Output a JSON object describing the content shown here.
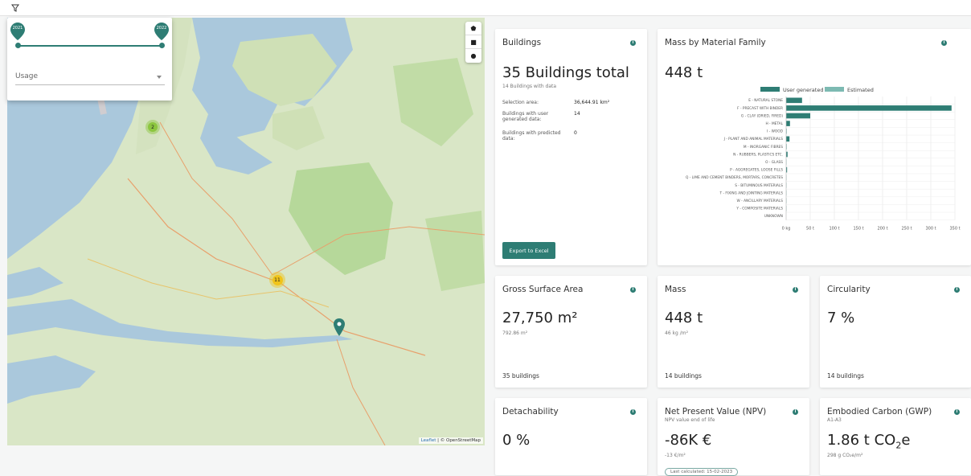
{
  "filter_panel": {
    "year_from": "2021",
    "year_to": "2022",
    "usage_placeholder": "Usage"
  },
  "map": {
    "clusters": [
      {
        "label": "2",
        "color": "#8cc63f"
      },
      {
        "label": "11",
        "color": "#f0c419"
      }
    ],
    "controls": [
      "pentagon-icon",
      "square-icon",
      "circle-icon"
    ],
    "attribution_leaflet": "Leaflet",
    "attribution_osm": "| © OpenStreetMap"
  },
  "buildings": {
    "title": "Buildings",
    "total": "35 Buildings total",
    "with_data": "14 Buildings with data",
    "rows": [
      {
        "label": "Selection area:",
        "value": "36,644.91 km²"
      },
      {
        "label": "Buildings with user generated data:",
        "value": "14"
      },
      {
        "label": "Buildings with predicted data:",
        "value": "0"
      }
    ],
    "export_label": "Export to Excel"
  },
  "mass_by_material": {
    "title": "Mass by Material Family",
    "value": "448 t",
    "legend_user": "User generated",
    "legend_estimated": "Estimated",
    "colors": {
      "user": "#2e7d74",
      "estimated": "#7dbab2"
    }
  },
  "chart_data": {
    "type": "bar",
    "orientation": "horizontal",
    "categories": [
      "E - NATURAL STONE",
      "F - PRECAST WITH BINDER",
      "G - CLAY (DRIED, FIRED)",
      "H - METAL",
      "I - WOOD",
      "J - PLANT AND ANIMAL MATERIALS",
      "M - INORGANIC FIBRES",
      "N - RUBBERS, PLASTICS ETC.",
      "O - GLASS",
      "P - AGGREGATES, LOOSE FILLS",
      "Q - LIME AND CEMENT BINDERS, MORTARS, CONCRETES",
      "S - BITUMINOUS MATERIALS",
      "T - FIXING AND JOINTING MATERIALS",
      "W - ANCILLARY MATERIALS",
      "Y - COMPOSITE MATERIALS",
      "UNKNOWN"
    ],
    "series": [
      {
        "name": "User generated",
        "values": [
          33,
          343,
          50,
          8,
          1,
          7,
          1,
          3,
          0.5,
          2,
          0.5,
          0.5,
          0.5,
          0.5,
          0.5,
          0
        ]
      },
      {
        "name": "Estimated",
        "values": [
          0,
          0,
          0,
          0,
          0,
          0,
          0,
          0,
          0,
          0,
          0,
          0,
          0,
          0,
          0,
          0
        ]
      }
    ],
    "x_ticks": [
      "0 kg",
      "50 t",
      "100 t",
      "150 t",
      "200 t",
      "250 t",
      "300 t",
      "350 t"
    ],
    "xlim": [
      0,
      350
    ],
    "grid": true,
    "legend": "top"
  },
  "gross_surface": {
    "title": "Gross Surface Area",
    "value": "27,750 m²",
    "sub": "792.86 m²",
    "foot": "35 buildings"
  },
  "mass": {
    "title": "Mass",
    "value": "448 t",
    "sub": "46 kg /m²",
    "foot": "14 buildings"
  },
  "circularity": {
    "title": "Circularity",
    "value": "7 %",
    "foot": "14 buildings"
  },
  "detachability": {
    "title": "Detachability",
    "value": "0 %"
  },
  "npv": {
    "title": "Net Present Value (NPV)",
    "subtitle": "NPV value end of life",
    "value": "-86K €",
    "sub": "-13 €/m²",
    "badge": "Last calculated: 15-02-2023"
  },
  "gwp": {
    "title": "Embodied Carbon (GWP)",
    "subtitle": "A1-A3",
    "value_num": "1.86 t CO",
    "value_sub": "2",
    "value_end": "e",
    "sub": "298 g CO₂e/m²"
  }
}
